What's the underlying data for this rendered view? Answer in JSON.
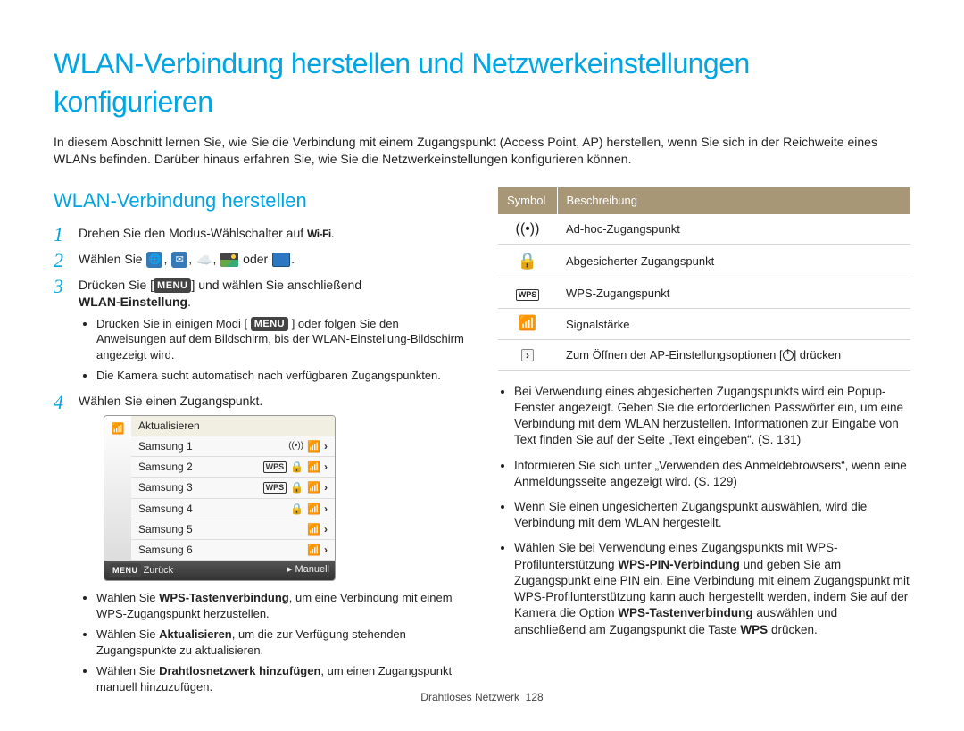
{
  "page_title": "WLAN-Verbindung herstellen und Netzwerkeinstellungen konfigurieren",
  "intro": "In diesem Abschnitt lernen Sie, wie Sie die Verbindung mit einem Zugangspunkt (Access Point, AP) herstellen, wenn Sie sich in der Reichweite eines WLANs befinden. Darüber hinaus erfahren Sie, wie Sie die Netzwerkeinstellungen konfigurieren können.",
  "section_heading": "WLAN-Verbindung herstellen",
  "steps": {
    "s1_pre": "Drehen Sie den Modus-Wählschalter auf ",
    "s1_wifi": "Wi-Fi",
    "s1_post": ".",
    "s2_pre": "Wählen Sie ",
    "s2_mid": ", ",
    "s2_or": " oder ",
    "s2_end": ".",
    "s3_pre": "Drücken Sie [",
    "s3_menu": "MENU",
    "s3_mid": "] und wählen Sie anschließend ",
    "s3_bold": "WLAN-Einstellung",
    "s3_post": ".",
    "s3_sub1_a": "Drücken Sie in einigen Modi [ ",
    "s3_sub1_b": " ] oder folgen Sie den Anweisungen auf dem Bildschirm, bis der WLAN-Einstellung-Bildschirm angezeigt wird.",
    "s3_sub2": "Die Kamera sucht automatisch nach verfügbaren Zugangspunkten.",
    "s4": "Wählen Sie einen Zugangspunkt.",
    "s4_sub_wps_a": "Wählen Sie ",
    "s4_sub_wps_b": "WPS-Tastenverbindung",
    "s4_sub_wps_c": ", um eine Verbindung mit einem WPS-Zugangspunkt herzustellen.",
    "s4_sub_refresh_a": "Wählen Sie ",
    "s4_sub_refresh_b": "Aktualisieren",
    "s4_sub_refresh_c": ", um die zur Verfügung stehenden Zugangspunkte zu aktualisieren.",
    "s4_sub_add_a": "Wählen Sie ",
    "s4_sub_add_b": "Drahtlosnetzwerk hinzufügen",
    "s4_sub_add_c": ", um einen Zugangspunkt manuell hinzuzufügen."
  },
  "screenshot": {
    "refresh": "Aktualisieren",
    "rows": [
      {
        "name": "Samsung 1",
        "icons": [
          "adhoc",
          "signal",
          "chev"
        ]
      },
      {
        "name": "Samsung 2",
        "icons": [
          "wps",
          "lock",
          "signal",
          "chev"
        ]
      },
      {
        "name": "Samsung 3",
        "icons": [
          "wps",
          "lock",
          "signal",
          "chev"
        ]
      },
      {
        "name": "Samsung 4",
        "icons": [
          "lock",
          "signal",
          "chev"
        ]
      },
      {
        "name": "Samsung 5",
        "icons": [
          "signal",
          "chev"
        ]
      },
      {
        "name": "Samsung 6",
        "icons": [
          "signal",
          "chev"
        ]
      }
    ],
    "footer_left": "Zurück",
    "footer_right": "Manuell"
  },
  "table": {
    "h1": "Symbol",
    "h2": "Beschreibung",
    "rows": [
      {
        "desc": "Ad-hoc-Zugangspunkt"
      },
      {
        "desc": "Abgesicherter Zugangspunkt"
      },
      {
        "desc": "WPS-Zugangspunkt"
      },
      {
        "desc": "Signalstärke"
      },
      {
        "desc_a": "Zum Öffnen der AP-Einstellungsoptionen [",
        "desc_b": "] drücken"
      }
    ]
  },
  "bullets": {
    "b1": "Bei Verwendung eines abgesicherten Zugangspunkts wird ein Popup-Fenster angezeigt. Geben Sie die erforderlichen Passwörter ein, um eine Verbindung mit dem WLAN herzustellen. Informationen zur Eingabe von Text finden Sie auf der Seite „Text eingeben“. (S. 131)",
    "b2": "Informieren Sie sich unter „Verwenden des Anmeldebrowsers“, wenn eine Anmeldungsseite angezeigt wird. (S. 129)",
    "b3": "Wenn Sie einen ungesicherten Zugangspunkt auswählen, wird die Verbindung mit dem WLAN hergestellt.",
    "b4_a": "Wählen Sie bei Verwendung eines Zugangspunkts mit WPS-Profilunterstützung ",
    "b4_b": "WPS-PIN-Verbindung",
    "b4_c": " und geben Sie am Zugangspunkt eine PIN ein. Eine Verbindung mit einem Zugangspunkt mit WPS-Profilunterstützung kann auch hergestellt werden, indem Sie auf der Kamera die Option ",
    "b4_d": "WPS-Tastenverbindung",
    "b4_e": " auswählen und anschließend am Zugangspunkt die Taste ",
    "b4_f": "WPS",
    "b4_g": " drücken."
  },
  "footer_section": "Drahtloses Netzwerk",
  "footer_page": "128"
}
